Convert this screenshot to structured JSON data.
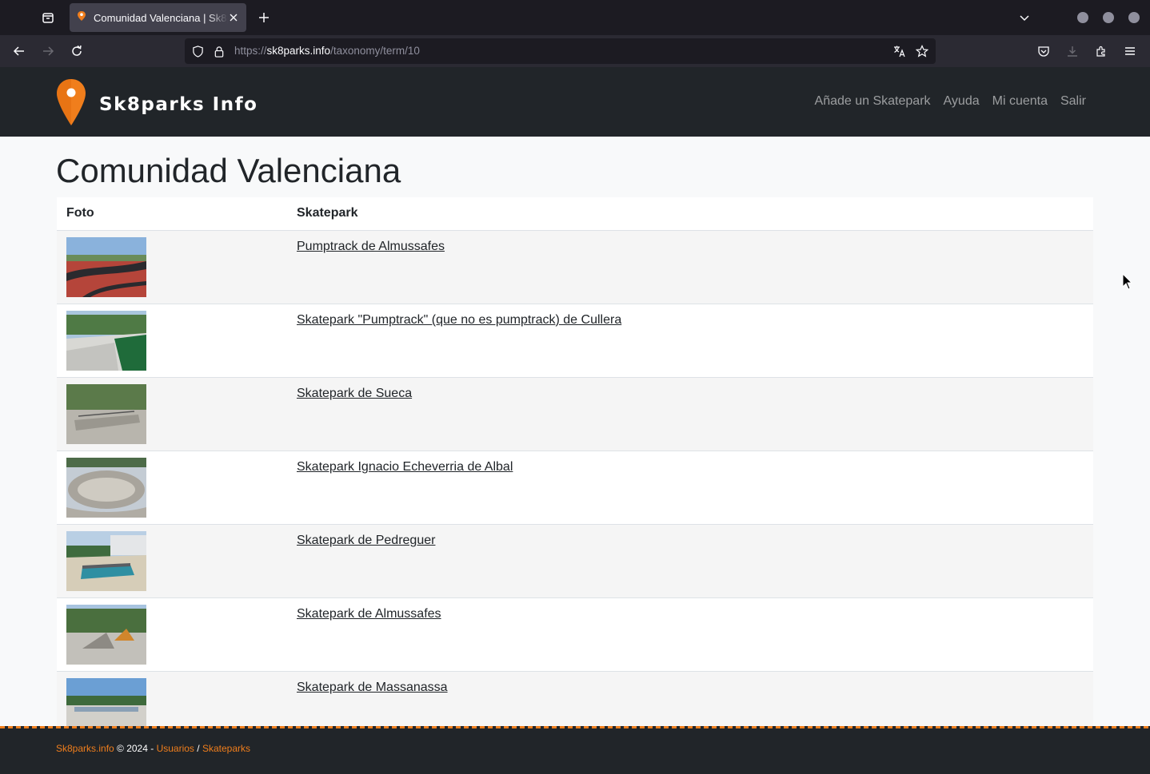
{
  "browser": {
    "tab_title": "Comunidad Valenciana | Sk8parks Info",
    "url_scheme": "https://",
    "url_host": "sk8parks.info",
    "url_path": "/taxonomy/term/10",
    "accent": "#f07e1c"
  },
  "header": {
    "brand": "Sk8parks Info",
    "nav": [
      "Añade un Skatepark",
      "Ayuda",
      "Mi cuenta",
      "Salir"
    ]
  },
  "page": {
    "title": "Comunidad Valenciana",
    "table": {
      "columns": [
        "Foto",
        "Skatepark"
      ],
      "rows": [
        {
          "name": "Pumptrack de Almussafes"
        },
        {
          "name": "Skatepark \"Pumptrack\" (que no es pumptrack) de Cullera"
        },
        {
          "name": "Skatepark de Sueca"
        },
        {
          "name": "Skatepark Ignacio Echeverria de Albal"
        },
        {
          "name": "Skatepark de Pedreguer"
        },
        {
          "name": "Skatepark de Almussafes"
        },
        {
          "name": "Skatepark de Massanassa"
        }
      ]
    }
  },
  "footer": {
    "site_link": "Sk8parks.info",
    "copyright": " © 2024 - ",
    "users_link": "Usuarios",
    "separator": " / ",
    "parks_link": "Skateparks"
  }
}
